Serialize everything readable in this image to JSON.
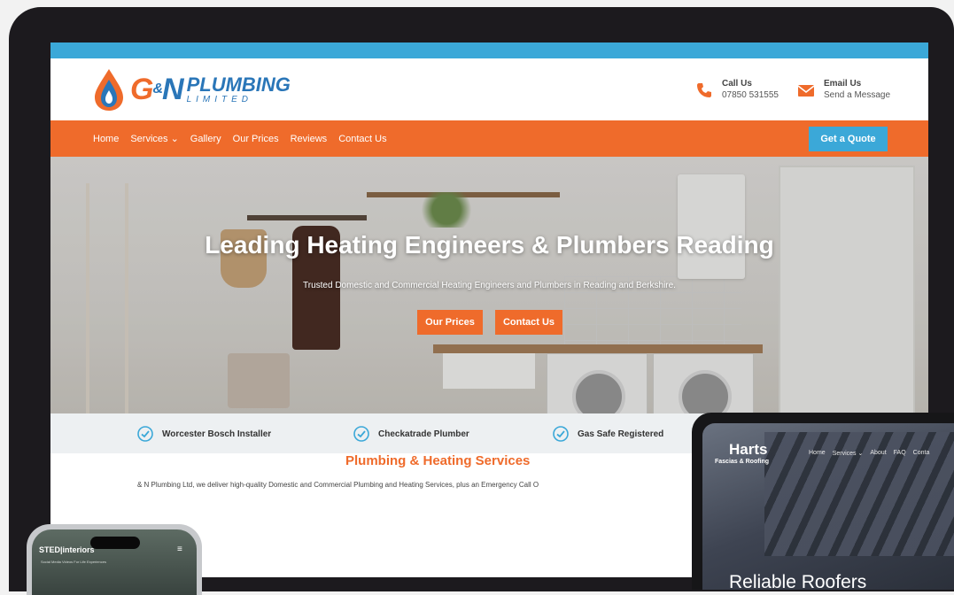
{
  "site": {
    "brand": {
      "letters_g": "G",
      "amp": "&",
      "letters_n": "N",
      "plumbing": "PLUMBING",
      "limited": "LIMITED"
    },
    "contacts": [
      {
        "title": "Call Us",
        "value": "07850 531555",
        "icon": "phone-icon"
      },
      {
        "title": "Email Us",
        "value": "Send a Message",
        "icon": "email-icon"
      }
    ],
    "nav": {
      "items": [
        "Home",
        "Services ⌄",
        "Gallery",
        "Our Prices",
        "Reviews",
        "Contact Us"
      ],
      "cta": "Get a Quote"
    },
    "hero": {
      "title": "Leading Heating Engineers & Plumbers Reading",
      "subtitle": "Trusted Domestic and Commercial Heating Engineers and Plumbers in Reading and Berkshire.",
      "buttons": [
        "Our Prices",
        "Contact Us"
      ]
    },
    "badges": [
      "Worcester Bosch Installer",
      "Checkatrade Plumber",
      "Gas Safe Registered"
    ],
    "services": {
      "title": "Plumbing & Heating Services",
      "text": "& N Plumbing Ltd, we deliver high-quality Domestic and Commercial Plumbing and Heating Services, plus an Emergency Call O"
    }
  },
  "tablet": {
    "logo": "Harts",
    "logo_sub": "Fascias & Roofing",
    "nav": [
      "Home",
      "Services ⌄",
      "About",
      "FAQ",
      "Conta"
    ],
    "headline": "Reliable Roofers"
  },
  "phone": {
    "logo": "STED|interiors",
    "tagline": "Social Media Videos For Life Experiences",
    "menu": "≡"
  },
  "colors": {
    "accent_orange": "#ef6b2b",
    "accent_blue": "#3ba8d8",
    "brand_blue": "#2a76b8"
  }
}
